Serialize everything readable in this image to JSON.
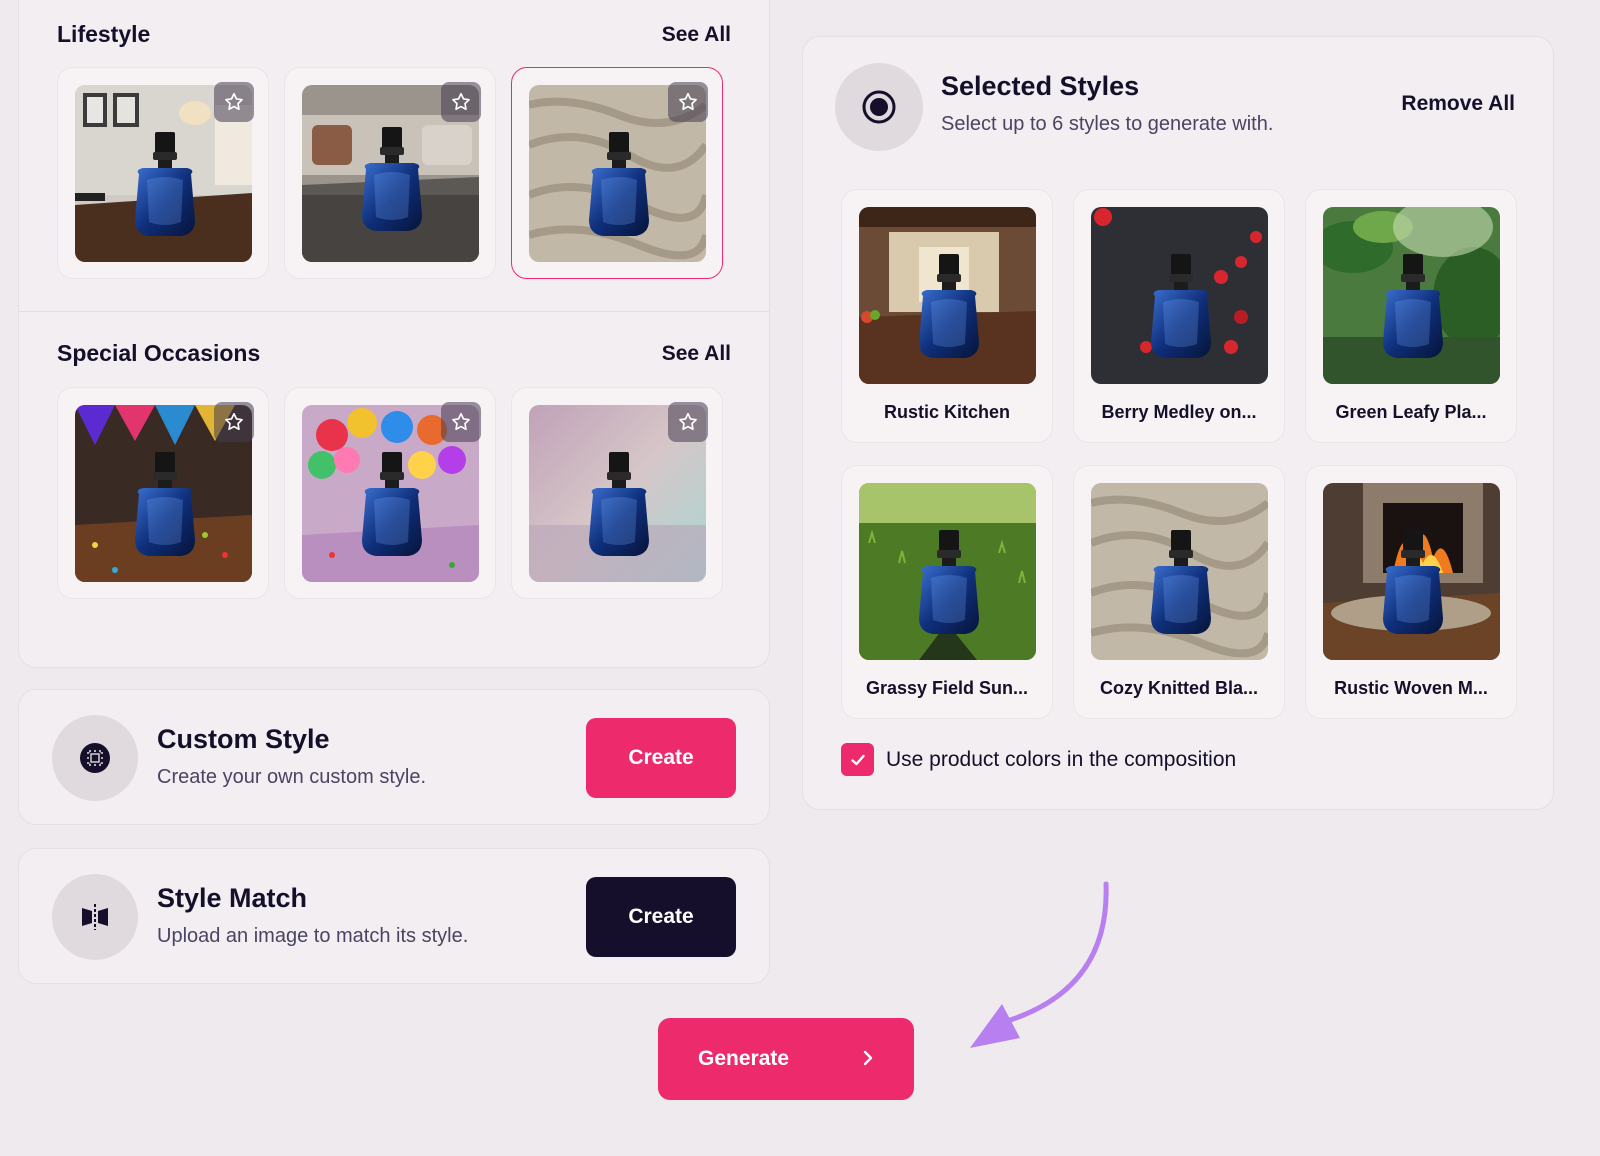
{
  "colors": {
    "accent": "#ec2a6c",
    "dark_button": "#150f2c",
    "arrow": "#b77ff0"
  },
  "lifestyle": {
    "title": "Lifestyle",
    "see_all": "See All"
  },
  "special_occasions": {
    "title": "Special Occasions",
    "see_all": "See All"
  },
  "custom_style": {
    "title": "Custom Style",
    "subtitle": "Create your own custom style.",
    "button": "Create",
    "icon": "sparkle-chip-icon"
  },
  "style_match": {
    "title": "Style Match",
    "subtitle": "Upload an image to match its style.",
    "button": "Create",
    "icon": "mirror-split-icon"
  },
  "selected_styles": {
    "title": "Selected Styles",
    "subtitle": "Select up to 6 styles to generate with.",
    "remove_all": "Remove All",
    "items": [
      {
        "label": "Rustic Kitchen"
      },
      {
        "label": "Berry Medley on..."
      },
      {
        "label": "Green Leafy Pla..."
      },
      {
        "label": "Grassy Field Sun..."
      },
      {
        "label": "Cozy Knitted Bla..."
      },
      {
        "label": "Rustic Woven M..."
      }
    ],
    "checkbox_label": "Use product colors in the composition",
    "checkbox_checked": true
  },
  "generate": {
    "label": "Generate"
  }
}
